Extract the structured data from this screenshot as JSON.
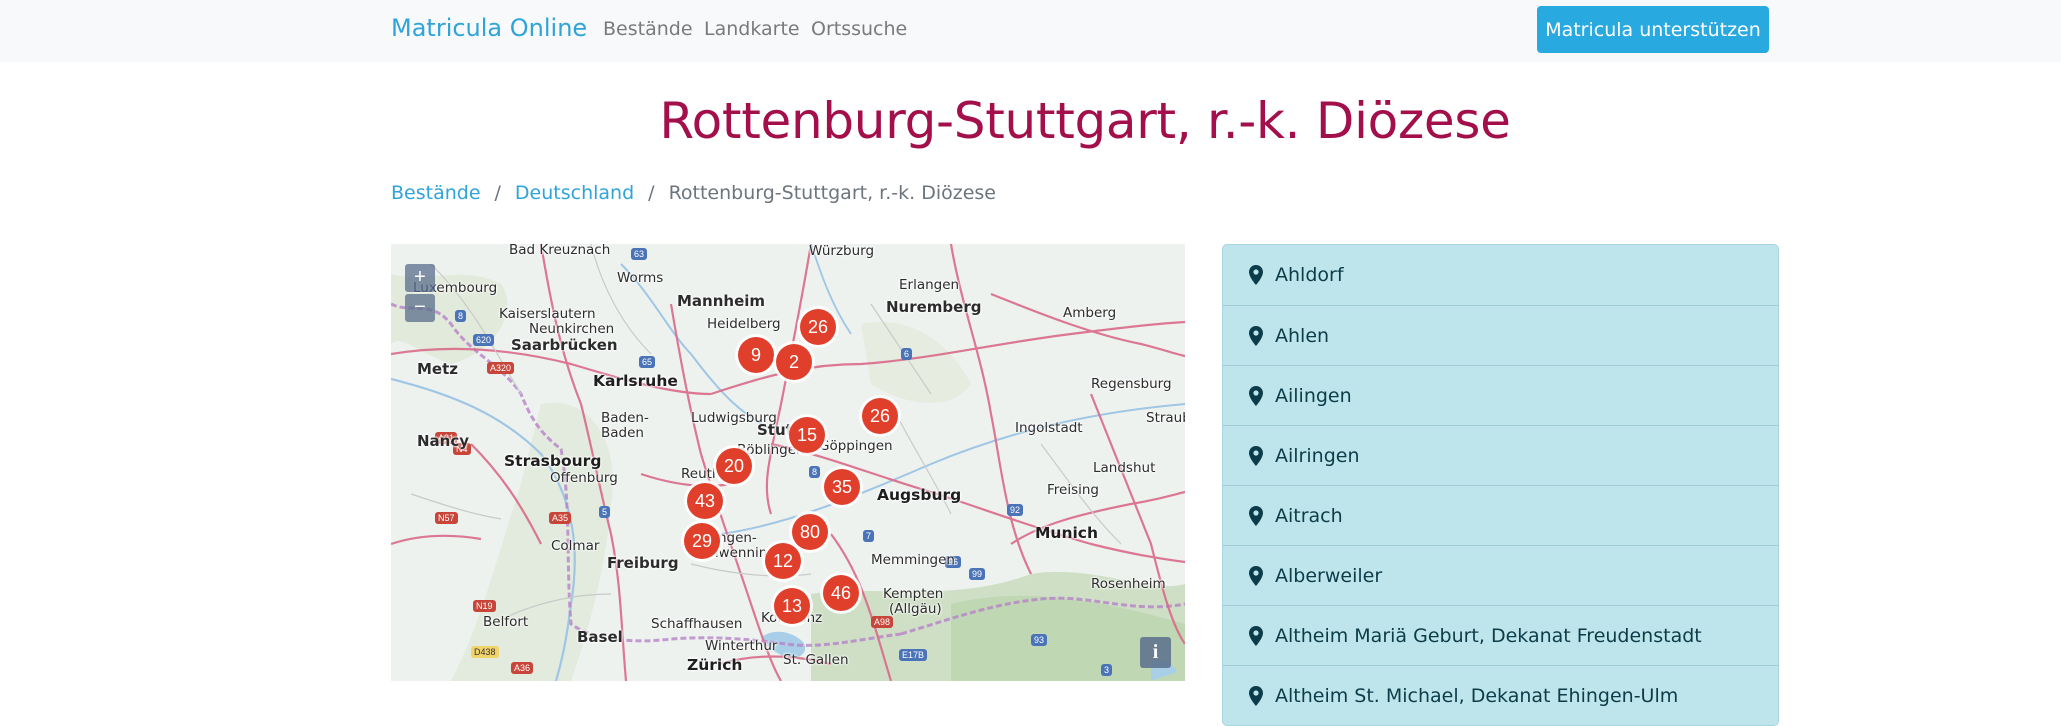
{
  "navbar": {
    "brand": "Matricula Online",
    "links": [
      "Bestände",
      "Landkarte",
      "Ortssuche"
    ],
    "support_label": "Matricula unterstützen"
  },
  "page": {
    "title": "Rottenburg-Stuttgart, r.-k. Diözese"
  },
  "breadcrumb": {
    "items": [
      "Bestände",
      "Deutschland"
    ],
    "current": "Rottenburg-Stuttgart, r.-k. Diözese"
  },
  "map": {
    "zoom_in": "+",
    "zoom_out": "−",
    "info": "i",
    "cities": [
      {
        "name": "Bad Kreuznach"
      },
      {
        "name": "Würzburg"
      },
      {
        "name": "Luxembourg"
      },
      {
        "name": "Worms"
      },
      {
        "name": "Mannheim"
      },
      {
        "name": "Erlangen"
      },
      {
        "name": "Kaiserslautern"
      },
      {
        "name": "Heidelberg"
      },
      {
        "name": "Nuremberg"
      },
      {
        "name": "Amberg"
      },
      {
        "name": "Neunkirchen"
      },
      {
        "name": "Saarbrücken"
      },
      {
        "name": "Metz"
      },
      {
        "name": "Karlsruhe"
      },
      {
        "name": "Regensburg"
      },
      {
        "name": "Baden-"
      },
      {
        "name": "Baden"
      },
      {
        "name": "Ludwigsburg"
      },
      {
        "name": "Straub"
      },
      {
        "name": "Nancy"
      },
      {
        "name": "Stutt"
      },
      {
        "name": "Ingolstadt"
      },
      {
        "name": "Strasbourg"
      },
      {
        "name": "Böblingen"
      },
      {
        "name": "Göppingen"
      },
      {
        "name": "Landshut"
      },
      {
        "name": "Offenburg"
      },
      {
        "name": "Reutl"
      },
      {
        "name": "Augsburg"
      },
      {
        "name": "Freising"
      },
      {
        "name": "Munich"
      },
      {
        "name": "Colmar"
      },
      {
        "name": "Villingen-"
      },
      {
        "name": "Schwenningen"
      },
      {
        "name": "Freiburg"
      },
      {
        "name": "Memmingen"
      },
      {
        "name": "Rosenheim"
      },
      {
        "name": "Kempten"
      },
      {
        "name": "(Allgäu)"
      },
      {
        "name": "Belfort"
      },
      {
        "name": "Schaffhausen"
      },
      {
        "name": "Konstanz"
      },
      {
        "name": "Basel"
      },
      {
        "name": "Winterthur"
      },
      {
        "name": "St. Gallen"
      },
      {
        "name": "Zürich"
      }
    ],
    "markers": [
      {
        "count": "26"
      },
      {
        "count": "9"
      },
      {
        "count": "2"
      },
      {
        "count": "26"
      },
      {
        "count": "15"
      },
      {
        "count": "20"
      },
      {
        "count": "35"
      },
      {
        "count": "43"
      },
      {
        "count": "80"
      },
      {
        "count": "29"
      },
      {
        "count": "12"
      },
      {
        "count": "46"
      },
      {
        "count": "13"
      }
    ],
    "road_shields": [
      "63",
      "8",
      "620",
      "65",
      "6",
      "A320",
      "A31",
      "N4",
      "5",
      "A35",
      "8",
      "7",
      "92",
      "96",
      "99",
      "93",
      "N57",
      "N19",
      "D438",
      "A98",
      "E17B",
      "A36",
      "3"
    ]
  },
  "places": [
    {
      "name": "Ahldorf"
    },
    {
      "name": "Ahlen"
    },
    {
      "name": "Ailingen"
    },
    {
      "name": "Ailringen"
    },
    {
      "name": "Aitrach"
    },
    {
      "name": "Alberweiler"
    },
    {
      "name": "Altheim Mariä Geburt, Dekanat Freudenstadt"
    },
    {
      "name": "Altheim St. Michael, Dekanat Ehingen-Ulm"
    }
  ],
  "colors": {
    "brand": "#2fa4d8",
    "title": "#a30f4a",
    "marker": "#e0402b",
    "list_bg": "#bee5eb",
    "list_text": "#0c3c4a"
  }
}
